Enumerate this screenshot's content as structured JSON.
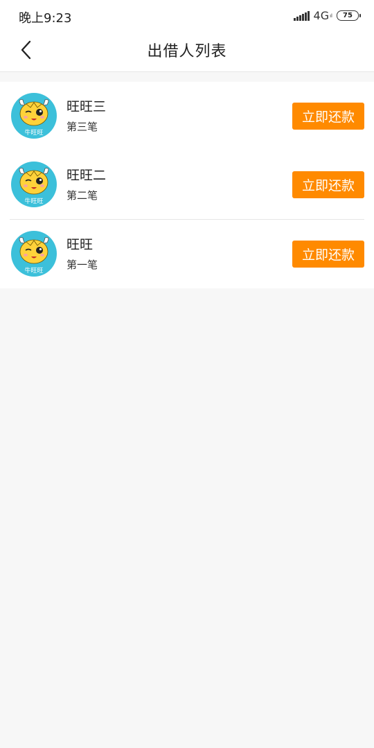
{
  "status_bar": {
    "time": "晚上9:23",
    "network": "4G",
    "network_sub": "ıl",
    "battery": "75"
  },
  "header": {
    "title": "出借人列表"
  },
  "lenders": [
    {
      "name": "旺旺三",
      "loan_count": "第三笔",
      "avatar_label": "牛旺旺",
      "action_label": "立即还款"
    },
    {
      "name": "旺旺二",
      "loan_count": "第二笔",
      "avatar_label": "牛旺旺",
      "action_label": "立即还款"
    },
    {
      "name": "旺旺",
      "loan_count": "第一笔",
      "avatar_label": "牛旺旺",
      "action_label": "立即还款"
    }
  ],
  "colors": {
    "accent": "#ff8a00",
    "avatar_bg": "#3cc0da",
    "mascot_yellow": "#ffd23a"
  },
  "icons": {
    "back": "chevron-left-icon",
    "signal": "signal-strength-icon",
    "battery": "battery-icon",
    "avatar": "cow-mascot-avatar"
  }
}
